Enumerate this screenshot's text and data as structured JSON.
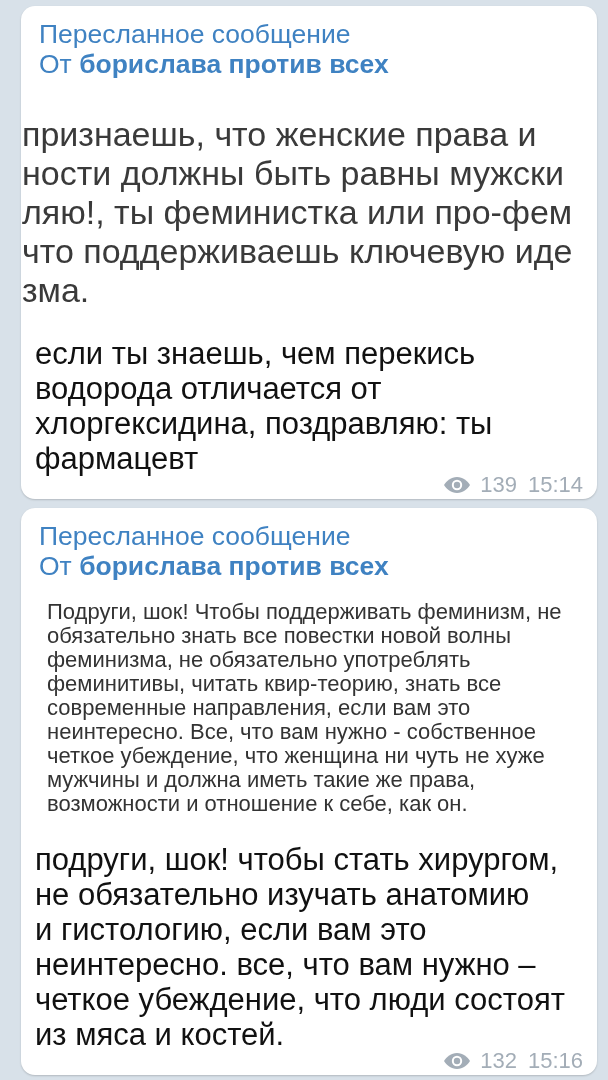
{
  "messages": [
    {
      "forward_label": "Пересланное сообщение",
      "forwarded_from": "От **борислава против всех**",
      "screenshot": {
        "kind": "cropped",
        "lines": [
          "признаешь, что женские права и",
          "ности должны быть равны мужски",
          "ляю!, ты феминистка или про-фем",
          "что поддерживаешь ключевую иде",
          "зма."
        ]
      },
      "text": "если ты знаешь, чем перекись водорода отличается от хлоргексидина, поздравляю: ты фармацевт",
      "views": "139",
      "time": "15:14"
    },
    {
      "forward_label": "Пересланное сообщение",
      "forwarded_from": "От **борислава против всех**",
      "screenshot": {
        "kind": "whole",
        "lines": [
          "Подруги, шок! Чтобы поддерживать феминизм, не",
          "обязательно знать все повестки новой волны",
          "феминизма, не обязательно употреблять",
          "феминитивы, читать квир-теорию, знать все",
          "современные направления, если вам это",
          "неинтересно. Все, что вам нужно - собственное",
          "четкое убеждение, что женщина ни чуть не хуже",
          "мужчины и должна иметь такие же права,",
          "возможности и отношение к себе, как он."
        ]
      },
      "text": "подруги, шок! чтобы стать хирургом, не обязательно изучать анатомию и гистологию, если вам это неинтересно. все, что вам нужно – четкое убеждение, что люди состоят из мяса и костей.",
      "views": "132",
      "time": "15:16"
    }
  ]
}
